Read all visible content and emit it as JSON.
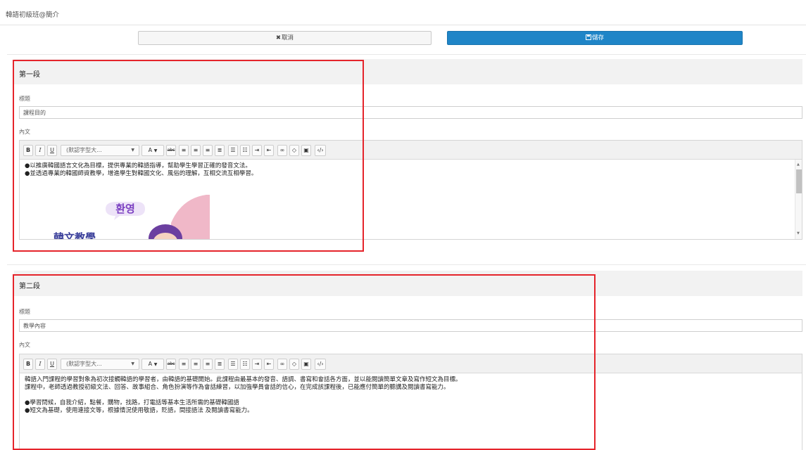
{
  "header": {
    "title": "韓語初級班@簡介"
  },
  "actions": {
    "cancel_label": "取消",
    "save_label": "儲存"
  },
  "toolbar": {
    "bold": "B",
    "italic": "I",
    "underline": "U",
    "font_size_placeholder": "(默認字型大...",
    "font_color": "A",
    "strikethrough": "abc"
  },
  "sections": [
    {
      "title": "第一段",
      "title_label": "標題",
      "title_value": "課程目的",
      "body_label": "內文",
      "body_lines": [
        "●以推廣韓國語言文化為目標，提供專業的韓語指導，幫助學生學習正確的發音文法。",
        "●並透過專業的韓國師資教學，增進學生對韓國文化、風俗的理解，互相交流互相學習。"
      ],
      "image_text": {
        "greeting": "환영",
        "caption": "韓文教學"
      }
    },
    {
      "title": "第二段",
      "title_label": "標題",
      "title_value": "教學內容",
      "body_label": "內文",
      "body_lines": [
        "韓語入門課程的學習對象為初次接觸韓語的學習者，由韓語的基礎開始。此課程由最基本的發音、語調、書寫和會話各方面，並以能閱讀簡單文章及寫作短文為目標。",
        "課程中，老師透過教授初級文法、回答、故事組合、角色扮演等作為會話練習，以加強學員會話的信心，在完成該課程後，已能應付簡單的聽講及閱讀書寫能力。",
        "●學習問候，自我介紹，點餐，購物，找路，打電話等基本生活所需的基礎韓國語",
        "●短文為基礎，使用連接文等，根據情況使用敬語，貶語，間接語法 及閱讀書寫能力。"
      ]
    }
  ],
  "colors": {
    "save_button": "#1f85c7",
    "highlight_border": "#e5242b",
    "section_header_bg": "#f2f2f2"
  },
  "icons": [
    "close-icon",
    "save-icon",
    "bold-icon",
    "italic-icon",
    "underline-icon",
    "font-color-icon",
    "strikethrough-icon",
    "align-left-icon",
    "align-center-icon",
    "align-right-icon",
    "align-justify-icon",
    "unordered-list-icon",
    "ordered-list-icon",
    "indent-icon",
    "outdent-icon",
    "link-icon",
    "unlink-icon",
    "image-icon",
    "source-code-icon"
  ]
}
